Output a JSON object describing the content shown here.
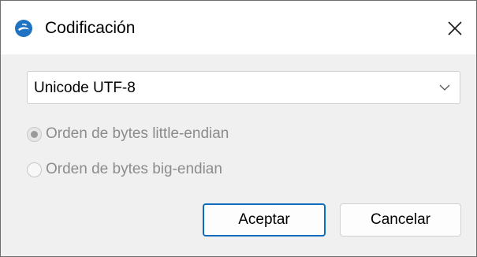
{
  "dialog": {
    "title": "Codificación",
    "app_icon": "app-logo-icon",
    "close_icon": "close-icon"
  },
  "encoding": {
    "selected": "Unicode UTF-8",
    "dropdown_icon": "chevron-down-icon"
  },
  "byte_order": {
    "little_endian": {
      "label": "Orden de bytes little-endian",
      "checked": true,
      "enabled": false
    },
    "big_endian": {
      "label": "Orden de bytes big-endian",
      "checked": false,
      "enabled": false
    }
  },
  "buttons": {
    "accept": "Aceptar",
    "cancel": "Cancelar"
  },
  "colors": {
    "accent": "#0f6cbd",
    "disabled_text": "#8c8c8c",
    "dialog_background": "#f0f0f0"
  }
}
